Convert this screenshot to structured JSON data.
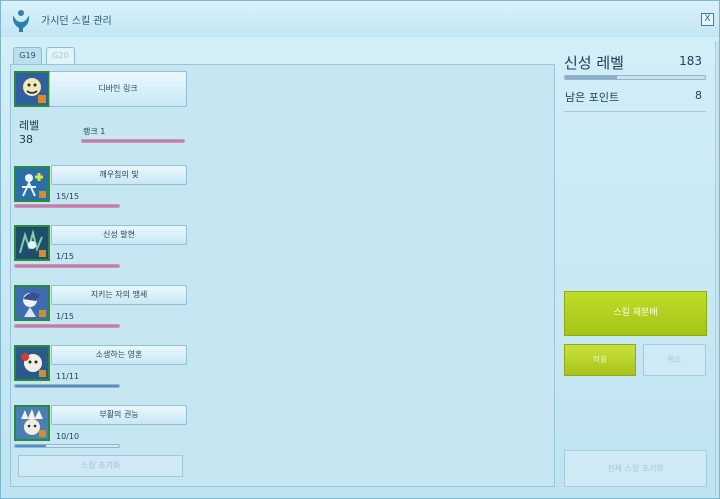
{
  "window": {
    "title": "가시던 스킬 관리",
    "close_label": "X"
  },
  "tabs": [
    {
      "label": "G19",
      "active": true
    },
    {
      "label": "G20",
      "active": false
    }
  ],
  "rank_skill": {
    "name": "디바인 링크"
  },
  "level": {
    "label": "레벨",
    "value": "38",
    "rank_label": "랭크 1",
    "rank_progress": 1.0
  },
  "skills": [
    {
      "name": "깨우침의 빛",
      "level": "15/15",
      "progress": 1.0,
      "bar_color": "pink"
    },
    {
      "name": "신성 발현",
      "level": "1/15",
      "progress": 1.0,
      "bar_color": "pink"
    },
    {
      "name": "지키는 자의 맹세",
      "level": "1/15",
      "progress": 1.0,
      "bar_color": "pink"
    },
    {
      "name": "소생하는 영혼",
      "level": "11/11",
      "progress": 1.0,
      "bar_color": "blue"
    },
    {
      "name": "부활의 권능",
      "level": "10/10",
      "progress": 0.3,
      "bar_color": "blue"
    }
  ],
  "skill_reset": {
    "label": "스킬 초기화"
  },
  "sidebar": {
    "title": "신성 레벨",
    "level_value": "183",
    "level_progress": 0.37,
    "remaining_label": "남은 포인트",
    "remaining_value": "8",
    "redistribute_label": "스킬 재분배",
    "apply_label": "적용",
    "cancel_label": "취소",
    "reset_all_label": "전체 스킬 초기화"
  },
  "colors": {
    "accent_green": "#aac81a",
    "progress_pink": "#c27cab",
    "progress_blue": "#4f8fc4",
    "icon_border": "#2b8a3a"
  }
}
